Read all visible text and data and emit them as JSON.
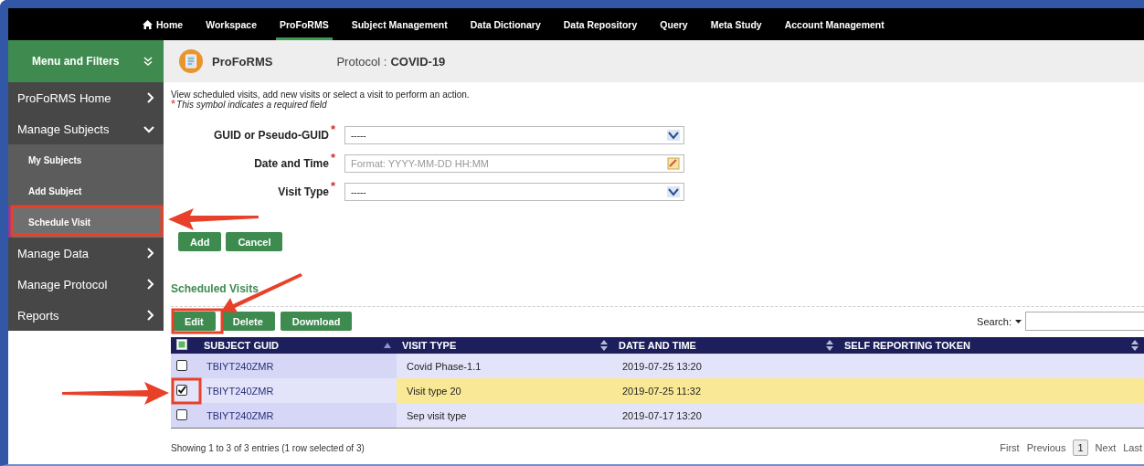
{
  "nav": {
    "items": [
      {
        "label": "Home",
        "selected": false
      },
      {
        "label": "Workspace",
        "selected": false
      },
      {
        "label": "ProFoRMS",
        "selected": true
      },
      {
        "label": "Subject Management",
        "selected": false
      },
      {
        "label": "Data Dictionary",
        "selected": false
      },
      {
        "label": "Data Repository",
        "selected": false
      },
      {
        "label": "Query",
        "selected": false
      },
      {
        "label": "Meta Study",
        "selected": false
      },
      {
        "label": "Account Management",
        "selected": false
      }
    ]
  },
  "sidebar": {
    "header": "Menu and Filters",
    "items": [
      {
        "label": "ProFoRMS Home",
        "expanded": false,
        "selected": false
      },
      {
        "label": "Manage Subjects",
        "expanded": true,
        "selected": false,
        "children": [
          {
            "label": "My Subjects",
            "selected": false
          },
          {
            "label": "Add Subject",
            "selected": false
          },
          {
            "label": "Schedule Visit",
            "selected": true
          }
        ]
      },
      {
        "label": "Manage Data",
        "expanded": false,
        "selected": false
      },
      {
        "label": "Manage Protocol",
        "expanded": false,
        "selected": false
      },
      {
        "label": "Reports",
        "expanded": false,
        "selected": false
      }
    ]
  },
  "page_header": {
    "title": "ProFoRMS",
    "protocol_label": "Protocol :",
    "protocol": "COVID-19"
  },
  "instructions": "View scheduled visits, add new visits or select a visit to perform an action.",
  "required_note": {
    "mark": "*",
    "text": "This symbol indicates a required field"
  },
  "form": {
    "fields": [
      {
        "kind": "select",
        "label": "GUID or Pseudo-GUID",
        "required_mark": "*",
        "value": "-----"
      },
      {
        "kind": "date",
        "label": "Date and Time",
        "required_mark": "*",
        "placeholder": "Format: YYYY-MM-DD HH:MM"
      },
      {
        "kind": "select",
        "label": "Visit Type",
        "required_mark": "*",
        "value": "-----"
      }
    ],
    "buttons": [
      "Add",
      "Cancel"
    ]
  },
  "scheduled_visits": {
    "title": "Scheduled Visits",
    "buttons": [
      "Edit",
      "Delete",
      "Download"
    ],
    "search": {
      "label": "Search:"
    },
    "table": {
      "header_checkbox": {
        "partial": true
      },
      "columns": [
        {
          "label": "SUBJECT GUID",
          "sorted": true
        },
        {
          "label": "VISIT TYPE",
          "sorted": false
        },
        {
          "label": "DATE AND TIME",
          "sorted": false
        },
        {
          "label": "SELF REPORTING TOKEN",
          "sorted": false
        }
      ],
      "rows": [
        {
          "checked": false,
          "selected": false,
          "cells": [
            "TBIYT240ZMR",
            "Covid Phase-1.1",
            "2019-07-25 13:20"
          ]
        },
        {
          "checked": true,
          "selected": true,
          "cells": [
            "TBIYT240ZMR",
            "Visit type 20",
            "2019-07-25 11:32"
          ]
        },
        {
          "checked": false,
          "selected": false,
          "cells": [
            "TBIYT240ZMR",
            "Sep visit type",
            "2019-07-17 13:20"
          ]
        }
      ]
    },
    "info": "Showing 1 to 3 of 3 entries (1 row selected of 3)",
    "pagination": [
      {
        "label": "First",
        "selected": false
      },
      {
        "label": "Previous",
        "selected": false
      },
      {
        "label": "1",
        "selected": true
      },
      {
        "label": "Next",
        "selected": false
      },
      {
        "label": "Last",
        "selected": false
      }
    ]
  }
}
